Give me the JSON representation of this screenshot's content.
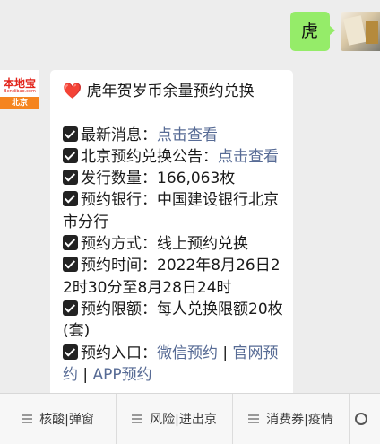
{
  "outgoing": {
    "text": "虎"
  },
  "incoming": {
    "avatar": {
      "logo": "本地宝",
      "logo_sub": "Bendibao.com",
      "city": "北京"
    },
    "title_icon": "❤️",
    "title": "虎年贺岁币余量预约兑换",
    "items": [
      {
        "label": "最新消息：",
        "value": "",
        "link": "点击查看"
      },
      {
        "label": "北京预约兑换公告：",
        "value": "",
        "link": "点击查看"
      },
      {
        "label": "发行数量：",
        "value": "166,063枚",
        "link": ""
      },
      {
        "label": "预约银行：",
        "value": "中国建设银行北京市分行",
        "link": ""
      },
      {
        "label": "预约方式：",
        "value": "线上预约兑换",
        "link": ""
      },
      {
        "label": "预约时间：",
        "value": "2022年8月26日22时30分至8月28日24时",
        "link": ""
      },
      {
        "label": "预约限额：",
        "value": "每人兑换限额20枚(套)",
        "link": ""
      },
      {
        "label": "预约入口：",
        "value": "",
        "links": [
          "微信预约",
          "官网预约",
          "APP预约"
        ],
        "separator": " | "
      }
    ]
  },
  "menu": {
    "items": [
      {
        "label": "核酸|弹窗"
      },
      {
        "label": "风险|进出京"
      },
      {
        "label": "消费券|疫情"
      }
    ]
  },
  "icons": {
    "check": "check-box-icon",
    "heart": "heart-icon",
    "menu": "menu-list-icon",
    "keyboard": "keyboard-icon"
  }
}
